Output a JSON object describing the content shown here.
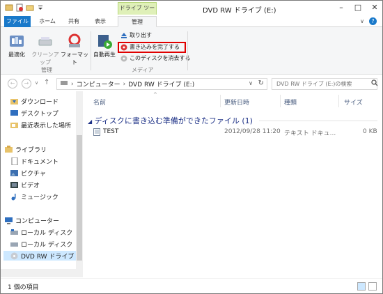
{
  "window": {
    "title": "DVD RW ドライブ (E:)",
    "context_tab_header": "ドライブ ツール"
  },
  "tabs": [
    "ファイル",
    "ホーム",
    "共有",
    "表示",
    "管理"
  ],
  "ribbon": {
    "group1": {
      "label": "管理",
      "buttons": [
        "最適化",
        "クリーンアップ",
        "フォーマット"
      ]
    },
    "group2": {
      "label": "メディア",
      "autoplay": "自動再生",
      "small": [
        "取り出す",
        "書き込みを完了する",
        "このディスクを消去する"
      ]
    }
  },
  "address": {
    "crumbs": [
      "コンピューター",
      "DVD RW ドライブ (E:)"
    ],
    "search_placeholder": "DVD RW ドライブ (E:)の検索"
  },
  "nav": {
    "items": [
      {
        "label": "ダウンロード",
        "icon": "download-folder-icon"
      },
      {
        "label": "デスクトップ",
        "icon": "desktop-icon"
      },
      {
        "label": "最近表示した場所",
        "icon": "recent-places-icon"
      },
      {
        "label": "ライブラリ",
        "icon": "library-icon"
      },
      {
        "label": "ドキュメント",
        "icon": "documents-icon"
      },
      {
        "label": "ピクチャ",
        "icon": "pictures-icon"
      },
      {
        "label": "ビデオ",
        "icon": "videos-icon"
      },
      {
        "label": "ミュージック",
        "icon": "music-icon"
      },
      {
        "label": "コンピューター",
        "icon": "computer-icon"
      },
      {
        "label": "ローカル ディスク",
        "icon": "local-disk-icon"
      },
      {
        "label": "ローカル ディスク",
        "icon": "local-disk-icon"
      },
      {
        "label": "DVD RW ドライブ",
        "icon": "dvd-drive-icon"
      }
    ]
  },
  "columns": [
    "名前",
    "更新日時",
    "種類",
    "サイズ"
  ],
  "group_header": "ディスクに書き込む準備ができたファイル (1)",
  "files": [
    {
      "name": "TEST",
      "modified": "2012/09/28 11:20",
      "type": "テキスト ドキュ...",
      "size": "0 KB"
    }
  ],
  "status": {
    "count": "1 個の項目"
  },
  "colors": {
    "file_tab": "#1979ca",
    "context_tab": "#dff0b8",
    "highlight": "#e00000",
    "group_header": "#1e3287"
  }
}
